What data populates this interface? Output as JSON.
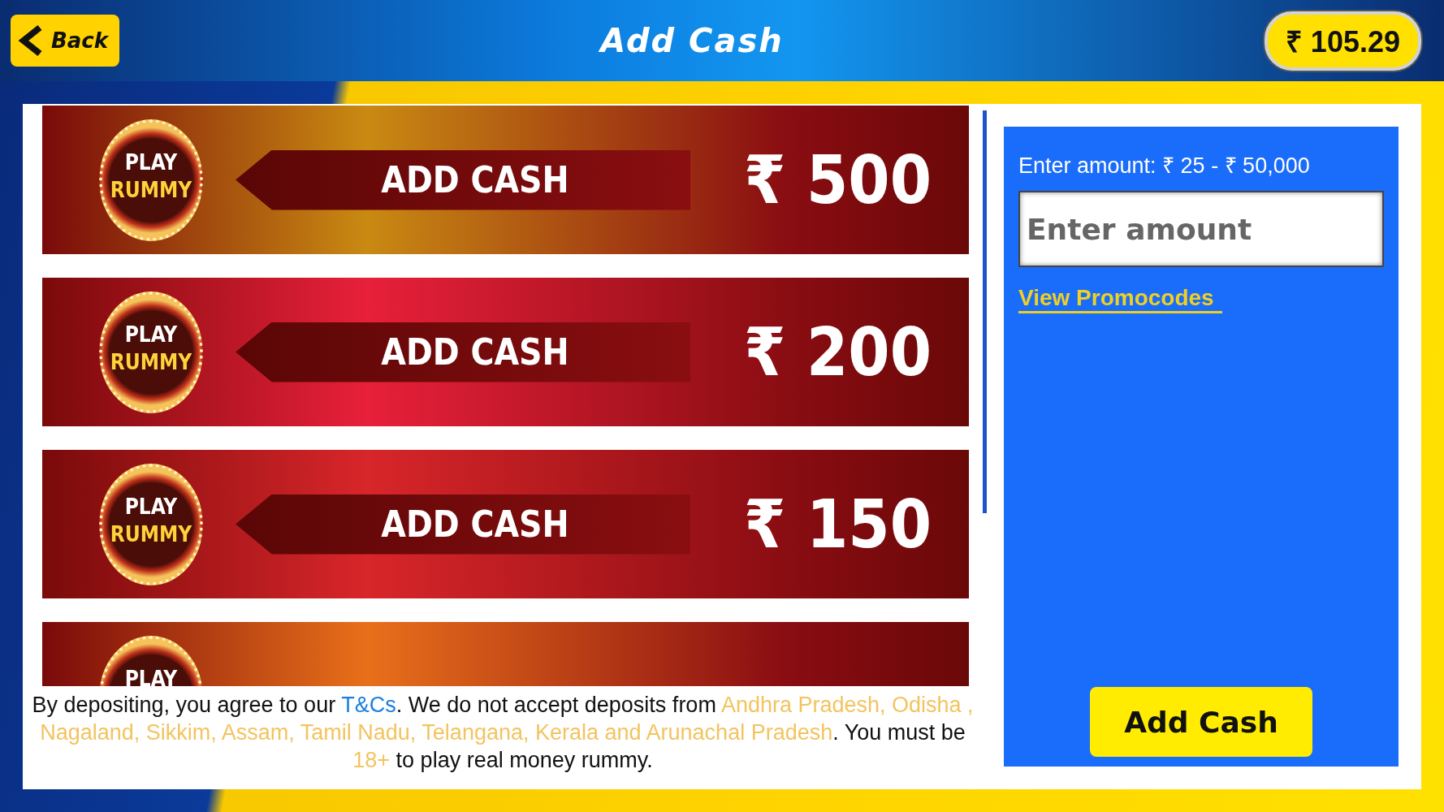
{
  "header": {
    "back_label": "Back",
    "title": "Add Cash",
    "balance": "₹ 105.29"
  },
  "banners": [
    {
      "color": "#c98a12",
      "badge_top": "PLAY",
      "badge_bottom": "RUMMY",
      "label": "ADD CASH",
      "amount": "₹ 500"
    },
    {
      "color": "#e8203a",
      "badge_top": "PLAY",
      "badge_bottom": "RUMMY",
      "label": "ADD CASH",
      "amount": "₹ 200"
    },
    {
      "color": "#d8262a",
      "badge_top": "PLAY",
      "badge_bottom": "RUMMY",
      "label": "ADD CASH",
      "amount": "₹ 150"
    },
    {
      "color": "#e8701a",
      "badge_top": "PLAY"
    }
  ],
  "disclaimer": [
    {
      "kind": "plain",
      "text": "By depositing, you agree to our "
    },
    {
      "kind": "link",
      "text": "T&Cs"
    },
    {
      "kind": "plain",
      "text": ". We do not accept deposits from "
    },
    {
      "kind": "highlight",
      "text": "Andhra Pradesh, Odisha , Nagaland, Sikkim, Assam, Tamil Nadu, Telangana, Kerala and Arunachal Pradesh"
    },
    {
      "kind": "plain",
      "text": ". You must be "
    },
    {
      "kind": "highlight",
      "text": "18+"
    },
    {
      "kind": "plain",
      "text": " to play real money rummy."
    }
  ],
  "amount_panel": {
    "range_label": "Enter amount: ₹ 25 - ₹ 50,000",
    "placeholder": "Enter amount",
    "promo_link": "View Promocodes",
    "submit": "Add Cash"
  }
}
